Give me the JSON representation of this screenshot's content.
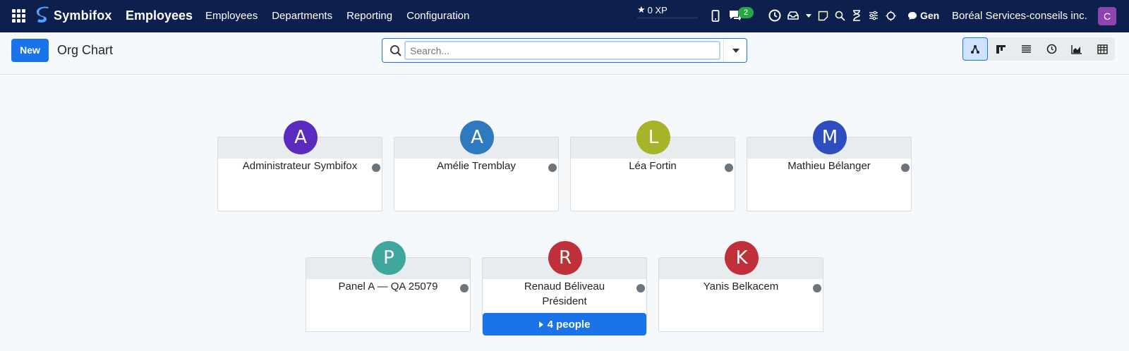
{
  "nav": {
    "brand": "Symbifox",
    "app_title": "Employees",
    "menu": [
      "Employees",
      "Departments",
      "Reporting",
      "Configuration"
    ],
    "xp": "0 XP",
    "messages_count": "2",
    "gen_label": "Gen",
    "company": "Boréal Services-conseils inc.",
    "user_initial": "C"
  },
  "control": {
    "new_label": "New",
    "breadcrumb": "Org Chart",
    "search_placeholder": "Search...",
    "views": [
      "org-chart",
      "kanban",
      "list",
      "activity",
      "graph",
      "pivot"
    ],
    "active_view": "org-chart"
  },
  "employees": [
    {
      "initial": "A",
      "name": "Administrateur Symbifox",
      "job": "",
      "color": "#5b2bbf"
    },
    {
      "initial": "A",
      "name": "Amélie Tremblay",
      "job": "",
      "color": "#2f7abf"
    },
    {
      "initial": "L",
      "name": "Léa Fortin",
      "job": "",
      "color": "#a8b327"
    },
    {
      "initial": "M",
      "name": "Mathieu Bélanger",
      "job": "",
      "color": "#2e4dbf"
    },
    {
      "initial": "P",
      "name": "Panel A — QA 25079",
      "job": "",
      "color": "#3fa79e"
    },
    {
      "initial": "R",
      "name": "Renaud Béliveau",
      "job": "Président",
      "color": "#c0303a",
      "people": "4 people"
    },
    {
      "initial": "K",
      "name": "Yanis Belkacem",
      "job": "",
      "color": "#c0303a"
    }
  ]
}
